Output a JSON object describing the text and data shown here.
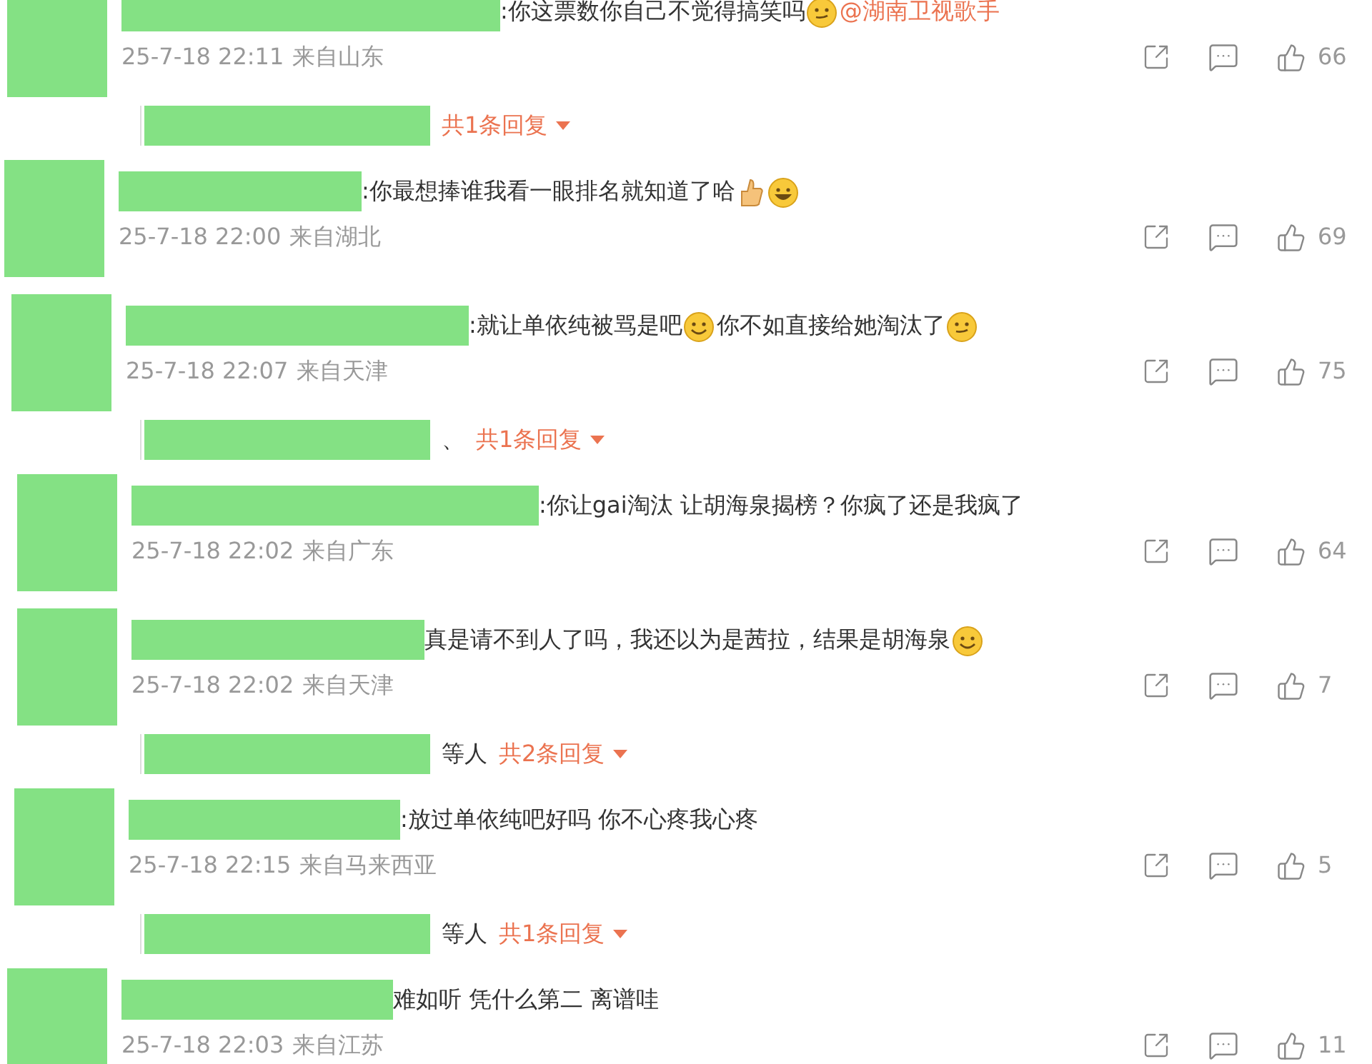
{
  "comments": [
    {
      "segments": [
        {
          "kind": "text",
          "text": ":你这票数你自己不觉得搞笑吗"
        },
        {
          "kind": "wink"
        },
        {
          "kind": "mention",
          "text": "@湖南卫视歌手"
        }
      ],
      "time": "25-7-18 22:11",
      "location": "来自山东",
      "likes": "66",
      "reply": {
        "count": "共1条回复"
      }
    },
    {
      "segments": [
        {
          "kind": "text",
          "text": ":你最想捧谁我看一眼排名就知道了哈"
        },
        {
          "kind": "thumb"
        },
        {
          "kind": "laugh"
        }
      ],
      "time": "25-7-18 22:00",
      "location": "来自湖北",
      "likes": "69"
    },
    {
      "segments": [
        {
          "kind": "text",
          "text": ":就让单依纯被骂是吧"
        },
        {
          "kind": "smile"
        },
        {
          "kind": "text",
          "text": "你不如直接给她淘汰了"
        },
        {
          "kind": "wink"
        }
      ],
      "time": "25-7-18 22:07",
      "location": "来自天津",
      "likes": "75",
      "reply": {
        "prefix": "、",
        "count": "共1条回复"
      }
    },
    {
      "segments": [
        {
          "kind": "text",
          "text": ":你让gai淘汰 让胡海泉揭榜？你疯了还是我疯了"
        }
      ],
      "time": "25-7-18 22:02",
      "location": "来自广东",
      "likes": "64"
    },
    {
      "segments": [
        {
          "kind": "text",
          "text": "真是请不到人了吗，我还以为是茜拉，结果是胡海泉"
        },
        {
          "kind": "smile"
        }
      ],
      "time": "25-7-18 22:02",
      "location": "来自天津",
      "likes": "7",
      "reply": {
        "prefix": "等人",
        "count": "共2条回复"
      }
    },
    {
      "segments": [
        {
          "kind": "text",
          "text": ":放过单依纯吧好吗 你不心疼我心疼"
        }
      ],
      "time": "25-7-18 22:15",
      "location": "来自马来西亚",
      "likes": "5",
      "reply": {
        "prefix": "等人",
        "count": "共1条回复"
      }
    },
    {
      "segments": [
        {
          "kind": "text",
          "text": "难如听 凭什么第二 离谱哇"
        }
      ],
      "time": "25-7-18 22:03",
      "location": "来自江苏",
      "likes": "11"
    }
  ]
}
